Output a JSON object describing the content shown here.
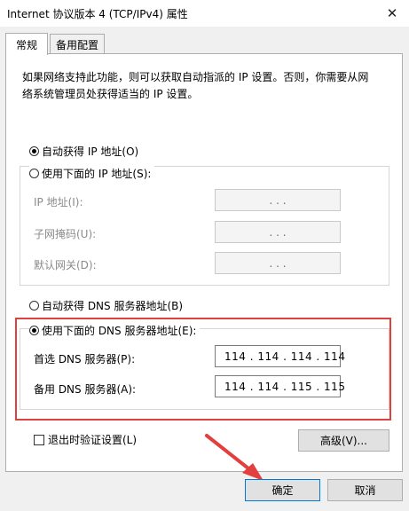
{
  "window": {
    "title": "Internet 协议版本 4 (TCP/IPv4) 属性",
    "close_glyph": "✕"
  },
  "tabs": [
    {
      "label": "常规",
      "active": true
    },
    {
      "label": "备用配置",
      "active": false
    }
  ],
  "description": "如果网络支持此功能，则可以获取自动指派的 IP 设置。否则，你需要从网络系统管理员处获得适当的 IP 设置。",
  "ip": {
    "auto_label": "自动获得 IP 地址(O)",
    "manual_label": "使用下面的 IP 地址(S):",
    "fields": [
      {
        "label": "IP 地址(I):",
        "value": ".   .   ."
      },
      {
        "label": "子网掩码(U):",
        "value": ".   .   ."
      },
      {
        "label": "默认网关(D):",
        "value": ".   .   ."
      }
    ]
  },
  "dns": {
    "auto_label": "自动获得 DNS 服务器地址(B)",
    "manual_label": "使用下面的 DNS 服务器地址(E):",
    "preferred_label": "首选 DNS 服务器(P):",
    "preferred_value": "114 . 114 . 114 . 114",
    "alternate_label": "备用 DNS 服务器(A):",
    "alternate_value": "114 . 114 . 115 . 115"
  },
  "validate_label": "退出时验证设置(L)",
  "advanced_label": "高级(V)...",
  "ok_label": "确定",
  "cancel_label": "取消",
  "accent_colors": {
    "highlight": "#e1403e",
    "focus": "#0078d7"
  }
}
